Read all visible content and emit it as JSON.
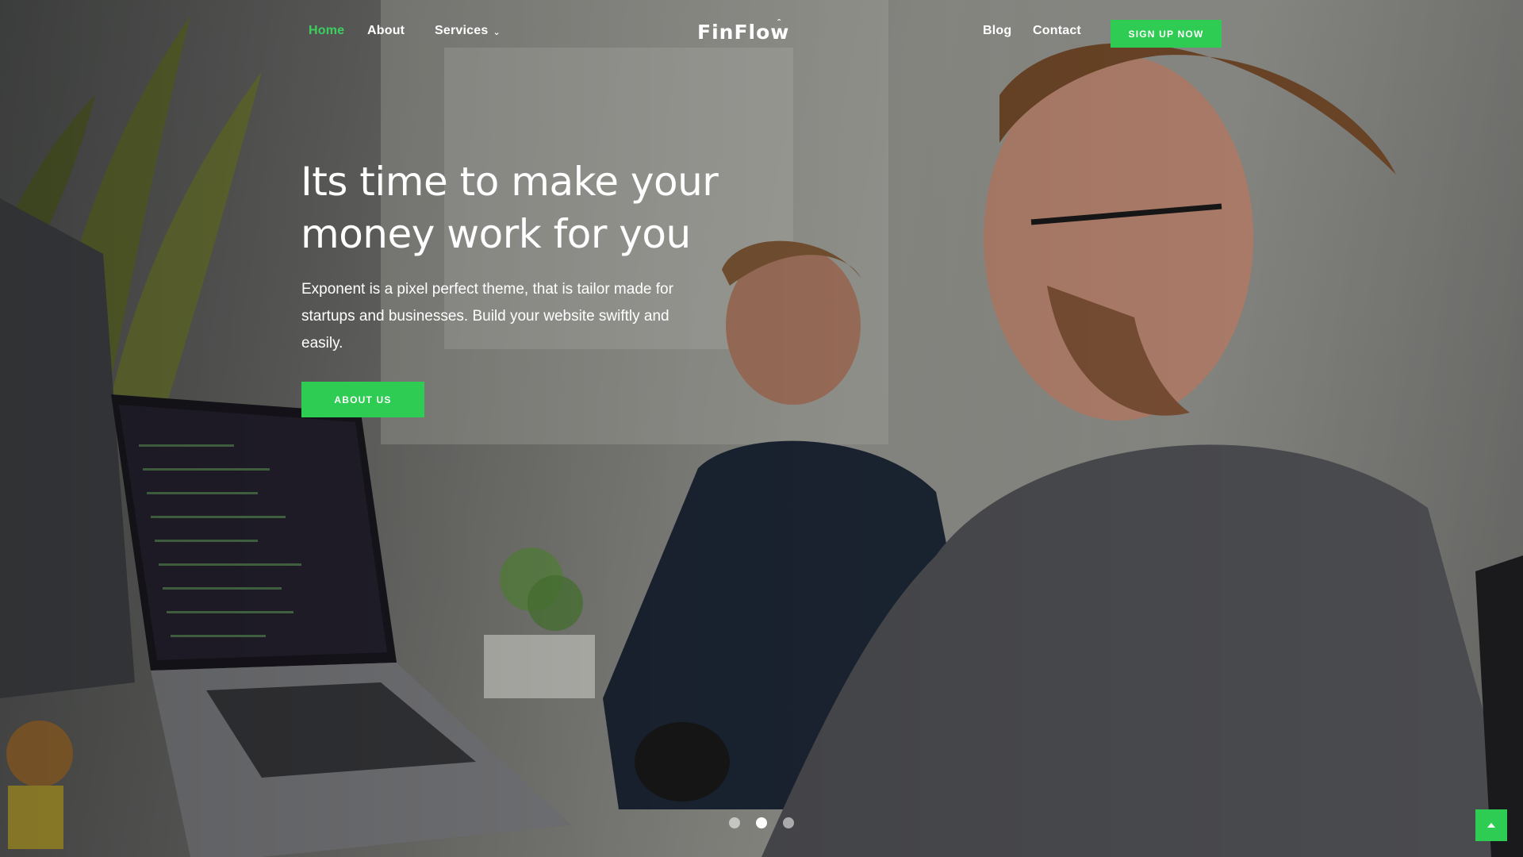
{
  "nav": {
    "home_label": "Home",
    "about_label": "About",
    "services_label": "Services",
    "blog_label": "Blog",
    "contact_label": "Contact",
    "signup_label": "SIGN UP NOW",
    "active_item": "Home"
  },
  "brand": {
    "logo_text": "FinFlow"
  },
  "hero": {
    "headline_line1": "Its time to make your",
    "headline_line2": "money work for you",
    "subtext": "Exponent is a pixel perfect theme, that is tailor made for startups and businesses. Build your website swiftly and easily.",
    "cta_label": "ABOUT US"
  },
  "slider": {
    "total_slides": 3,
    "active_slide": 2
  },
  "colors": {
    "accent": "#2ecc52",
    "active_link": "#3ccf60",
    "text": "#ffffff"
  },
  "icons": {
    "services_dropdown": "chevron-down-icon",
    "back_to_top": "arrow-up-icon"
  }
}
